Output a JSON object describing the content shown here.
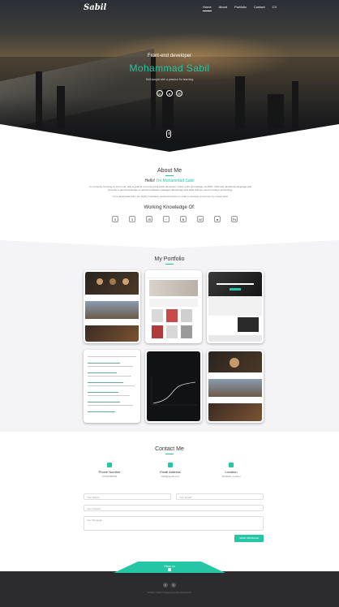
{
  "brand": {
    "logo": "Sabil"
  },
  "nav": {
    "items": [
      "Home",
      "About",
      "Portfolio",
      "Contact",
      "CV"
    ],
    "active_index": 0
  },
  "hero": {
    "subtitle": "Front-end developer",
    "name": "Mohammad Sabil",
    "tagline": "Self-taught with a passion for learning",
    "social_icons": [
      "linkedin-icon",
      "github-icon",
      "email-icon"
    ]
  },
  "about": {
    "title": "About Me",
    "hello_prefix": "Hello! ",
    "hello_name": "I'm Mohammad Sabil",
    "paragraph1": "I'm currently focusing on front-end, with a goal for me to be a full stack developer. I have a firm knowledge of HTML, CSS and JavaScript language and currently a good knowledge of relevant software packages (Bootstrap) and skills that are used in today's technology.",
    "paragraph2": "I'm a passionate that I am highly motivated, smart and driven in order to develop to become my career field.",
    "skills_title": "Working Knowledge Of:",
    "skills": [
      "HTML5",
      "CSS3",
      "JavaScript",
      "jQuery",
      "Bootstrap",
      "WordPress",
      "GitHub",
      "Photoshop"
    ]
  },
  "portfolio": {
    "title": "My Portfolio",
    "projects": [
      "restaurant-site",
      "fashion-store-site",
      "agency-site",
      "dashboard-site",
      "graph-project",
      "restaurant-site-2"
    ]
  },
  "contact": {
    "title": "Contact Me",
    "items": [
      {
        "label": "Phone Number",
        "value": "07342089636"
      },
      {
        "label": "Email Address",
        "value": "sabil@gmail.com"
      },
      {
        "label": "Location",
        "value": "Sheffield, London"
      }
    ],
    "form": {
      "name_placeholder": "Your Name*",
      "email_placeholder": "Your Email*",
      "subject_placeholder": "Your Subject",
      "message_placeholder": "Your Message",
      "send_label": "SEND MESSAGE"
    }
  },
  "footer": {
    "cv_label": "View cv",
    "social_icons": [
      "linkedin-icon",
      "github-icon"
    ],
    "copyright": "Portfolio | 2020 © Designed by Mohammad Sabil"
  },
  "colors": {
    "accent": "#24c6a6",
    "footer": "#2c2c2e",
    "section_bg": "#f4f4f6"
  }
}
